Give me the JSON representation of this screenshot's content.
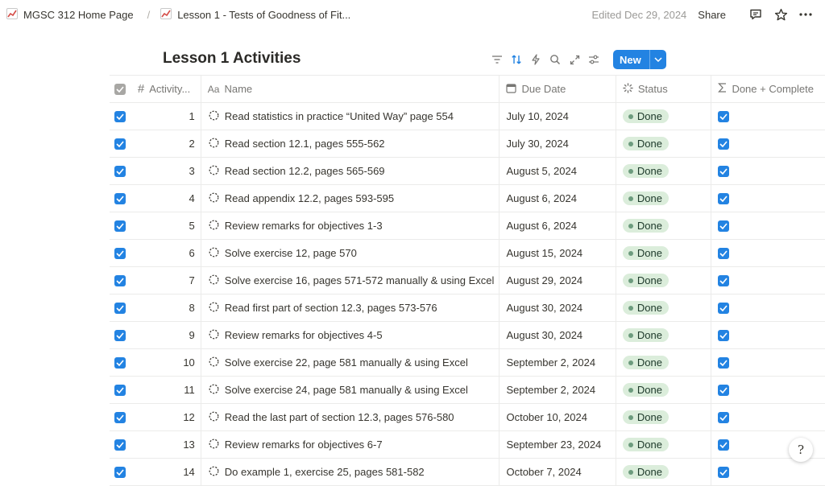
{
  "breadcrumb": {
    "items": [
      {
        "label": "MGSC 312 Home Page",
        "icon": "chart-increasing-icon"
      },
      {
        "label": "Lesson 1 - Tests of Goodness of Fit...",
        "icon": "chart-increasing-icon"
      }
    ],
    "separator": "/"
  },
  "topbar": {
    "edited": "Edited Dec 29, 2024",
    "share_label": "Share"
  },
  "page": {
    "title": "Lesson 1 Activities"
  },
  "toolbar": {
    "new_label": "New"
  },
  "table": {
    "columns": {
      "activity": "Activity...",
      "name": "Name",
      "due_date": "Due Date",
      "status": "Status",
      "done_complete": "Done + Complete"
    },
    "column_icons": {
      "activity": "#",
      "name": "Aa"
    },
    "rows": [
      {
        "num": "1",
        "name": "Read statistics in practice “United Way” page 554",
        "date": "July 10, 2024",
        "status": "Done"
      },
      {
        "num": "2",
        "name": "Read section 12.1, pages 555-562",
        "date": "July 30, 2024",
        "status": "Done"
      },
      {
        "num": "3",
        "name": "Read section 12.2, pages 565-569",
        "date": "August 5, 2024",
        "status": "Done"
      },
      {
        "num": "4",
        "name": "Read appendix 12.2, pages 593-595",
        "date": "August 6, 2024",
        "status": "Done"
      },
      {
        "num": "5",
        "name": "Review remarks for objectives 1-3",
        "date": "August 6, 2024",
        "status": "Done"
      },
      {
        "num": "6",
        "name": "Solve exercise 12, page 570",
        "date": "August 15, 2024",
        "status": "Done"
      },
      {
        "num": "7",
        "name": "Solve exercise 16, pages 571-572 manually & using Excel",
        "date": "August 29, 2024",
        "status": "Done"
      },
      {
        "num": "8",
        "name": "Read first part of section 12.3, pages 573-576",
        "date": "August 30, 2024",
        "status": "Done"
      },
      {
        "num": "9",
        "name": "Review remarks for objectives 4-5",
        "date": "August 30, 2024",
        "status": "Done"
      },
      {
        "num": "10",
        "name": "Solve exercise 22, page 581 manually & using Excel",
        "date": "September 2, 2024",
        "status": "Done"
      },
      {
        "num": "11",
        "name": "Solve exercise 24, page 581 manually & using Excel",
        "date": "September 2, 2024",
        "status": "Done"
      },
      {
        "num": "12",
        "name": "Read the last part of section 12.3, pages 576-580",
        "date": "October 10, 2024",
        "status": "Done"
      },
      {
        "num": "13",
        "name": "Review remarks for objectives 6-7",
        "date": "September 23, 2024",
        "status": "Done"
      },
      {
        "num": "14",
        "name": "Do example 1, exercise 25, pages 581-582",
        "date": "October 7, 2024",
        "status": "Done"
      }
    ]
  },
  "colors": {
    "accent": "#2383e2",
    "done_pill_bg": "#dbeddb",
    "done_dot": "#6c9b7d",
    "chart_icon": "#d44c47"
  }
}
